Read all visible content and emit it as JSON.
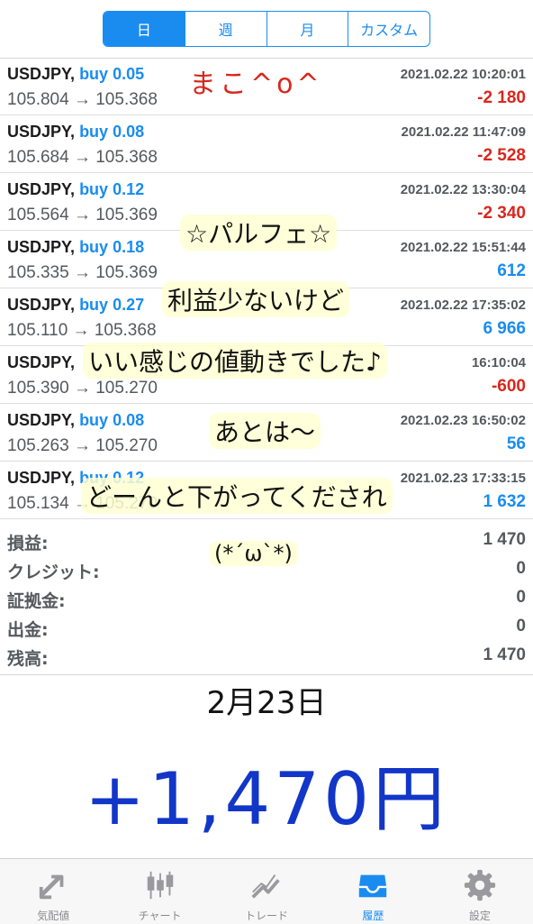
{
  "period_tabs": [
    {
      "label": "日",
      "active": true
    },
    {
      "label": "週",
      "active": false
    },
    {
      "label": "月",
      "active": false
    },
    {
      "label": "カスタム",
      "active": false
    }
  ],
  "trades": [
    {
      "symbol": "USDJPY,",
      "side": "buy 0.05",
      "prices": "105.804 → 105.368",
      "time": "2021.02.22 10:20:01",
      "profit": "-2 180",
      "profit_sign": "neg"
    },
    {
      "symbol": "USDJPY,",
      "side": "buy 0.08",
      "prices": "105.684 → 105.368",
      "time": "2021.02.22 11:47:09",
      "profit": "-2 528",
      "profit_sign": "neg"
    },
    {
      "symbol": "USDJPY,",
      "side": "buy 0.12",
      "prices": "105.564 → 105.369",
      "time": "2021.02.22 13:30:04",
      "profit": "-2 340",
      "profit_sign": "neg"
    },
    {
      "symbol": "USDJPY,",
      "side": "buy 0.18",
      "prices": "105.335 → 105.369",
      "time": "2021.02.22 15:51:44",
      "profit": "612",
      "profit_sign": "pos"
    },
    {
      "symbol": "USDJPY,",
      "side": "buy 0.27",
      "prices": "105.110 → 105.368",
      "time": "2021.02.22 17:35:02",
      "profit": "6 966",
      "profit_sign": "pos"
    },
    {
      "symbol": "USDJPY,",
      "side": "",
      "prices": "105.390 → 105.270",
      "time": "16:10:04",
      "profit": "-600",
      "profit_sign": "neg"
    },
    {
      "symbol": "USDJPY,",
      "side": "buy 0.08",
      "prices": "105.263 → 105.270",
      "time": "2021.02.23 16:50:02",
      "profit": "56",
      "profit_sign": "pos"
    },
    {
      "symbol": "USDJPY,",
      "side": "buy 0.12",
      "prices": "105.134 → 105.270",
      "time": "2021.02.23 17:33:15",
      "profit": "1 632",
      "profit_sign": "pos"
    }
  ],
  "summary": [
    {
      "label": "損益:",
      "value": "1 470"
    },
    {
      "label": "クレジット:",
      "value": "0"
    },
    {
      "label": "証拠金:",
      "value": "0"
    },
    {
      "label": "出金:",
      "value": "0"
    },
    {
      "label": "残高:",
      "value": "1 470"
    }
  ],
  "overlay": {
    "mako": "まこ^o^",
    "parfait": "☆パルフェ☆",
    "line1": "利益少ないけど",
    "line2": "いい感じの値動きでした♪",
    "line3": "あとは〜",
    "line4": "どーんと下がってくだされ",
    "face": "(*´ω`*)",
    "date": "2月23日",
    "amount": "+1,470円"
  },
  "tabs": [
    {
      "label": "気配値",
      "icon": "quotes-icon",
      "active": false
    },
    {
      "label": "チャート",
      "icon": "candlestick-chart-icon",
      "active": false
    },
    {
      "label": "トレード",
      "icon": "trade-trend-icon",
      "active": false
    },
    {
      "label": "履歴",
      "icon": "history-inbox-icon",
      "active": true
    },
    {
      "label": "設定",
      "icon": "gear-icon",
      "active": false
    }
  ],
  "colors": {
    "accent": "#1a8cf0",
    "loss": "#d8271d",
    "handwriting_blue": "#1236c8"
  }
}
